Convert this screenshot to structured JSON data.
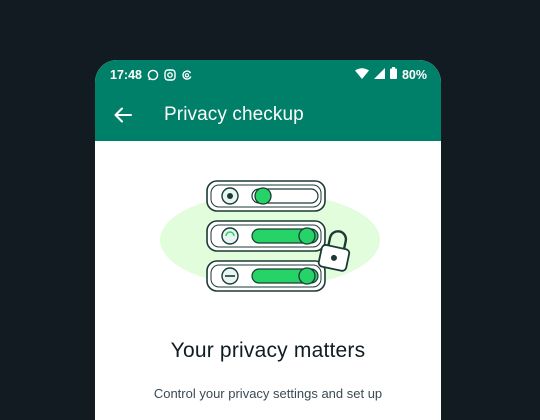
{
  "status_bar": {
    "time": "17:48",
    "left_icons": [
      "whatsapp-icon",
      "instagram-icon",
      "threads-icon"
    ],
    "right_icons": [
      "wifi-icon",
      "signal-icon",
      "battery-icon"
    ],
    "battery": "80%"
  },
  "app_bar": {
    "title": "Privacy checkup",
    "back_icon": "arrow-back-icon"
  },
  "main": {
    "headline": "Your privacy matters",
    "subtext": "Control your privacy settings and set up"
  },
  "colors": {
    "header_green": "#008069",
    "accent_green": "#25d366",
    "background": "#121b22"
  }
}
